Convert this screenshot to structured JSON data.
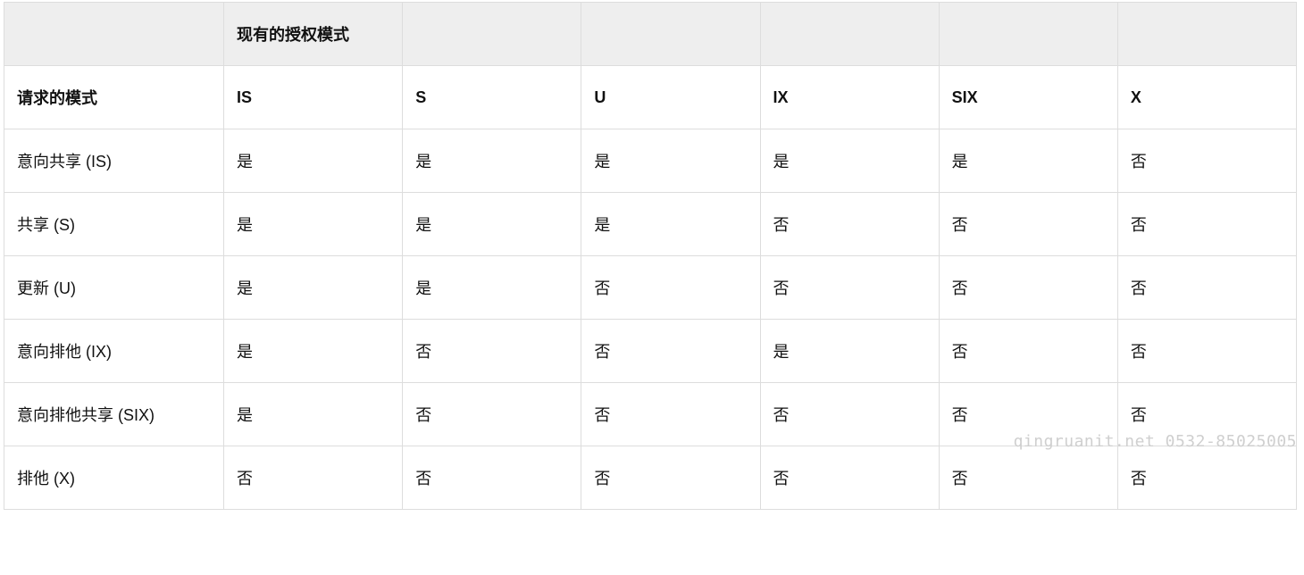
{
  "table": {
    "header": {
      "cells": [
        "",
        "现有的授权模式",
        "",
        "",
        "",
        "",
        ""
      ]
    },
    "rows": [
      {
        "label": "请求的模式",
        "cells": [
          "IS",
          "S",
          "U",
          "IX",
          "SIX",
          "X"
        ],
        "bold": true
      },
      {
        "label": "意向共享 (IS)",
        "cells": [
          "是",
          "是",
          "是",
          "是",
          "是",
          "否"
        ]
      },
      {
        "label": "共享 (S)",
        "cells": [
          "是",
          "是",
          "是",
          "否",
          "否",
          "否"
        ]
      },
      {
        "label": "更新 (U)",
        "cells": [
          "是",
          "是",
          "否",
          "否",
          "否",
          "否"
        ]
      },
      {
        "label": "意向排他 (IX)",
        "cells": [
          "是",
          "否",
          "否",
          "是",
          "否",
          "否"
        ]
      },
      {
        "label": "意向排他共享 (SIX)",
        "cells": [
          "是",
          "否",
          "否",
          "否",
          "否",
          "否"
        ]
      },
      {
        "label": "排他 (X)",
        "cells": [
          "否",
          "否",
          "否",
          "否",
          "否",
          "否"
        ]
      }
    ]
  },
  "watermark": "qingruanit.net 0532-85025005"
}
